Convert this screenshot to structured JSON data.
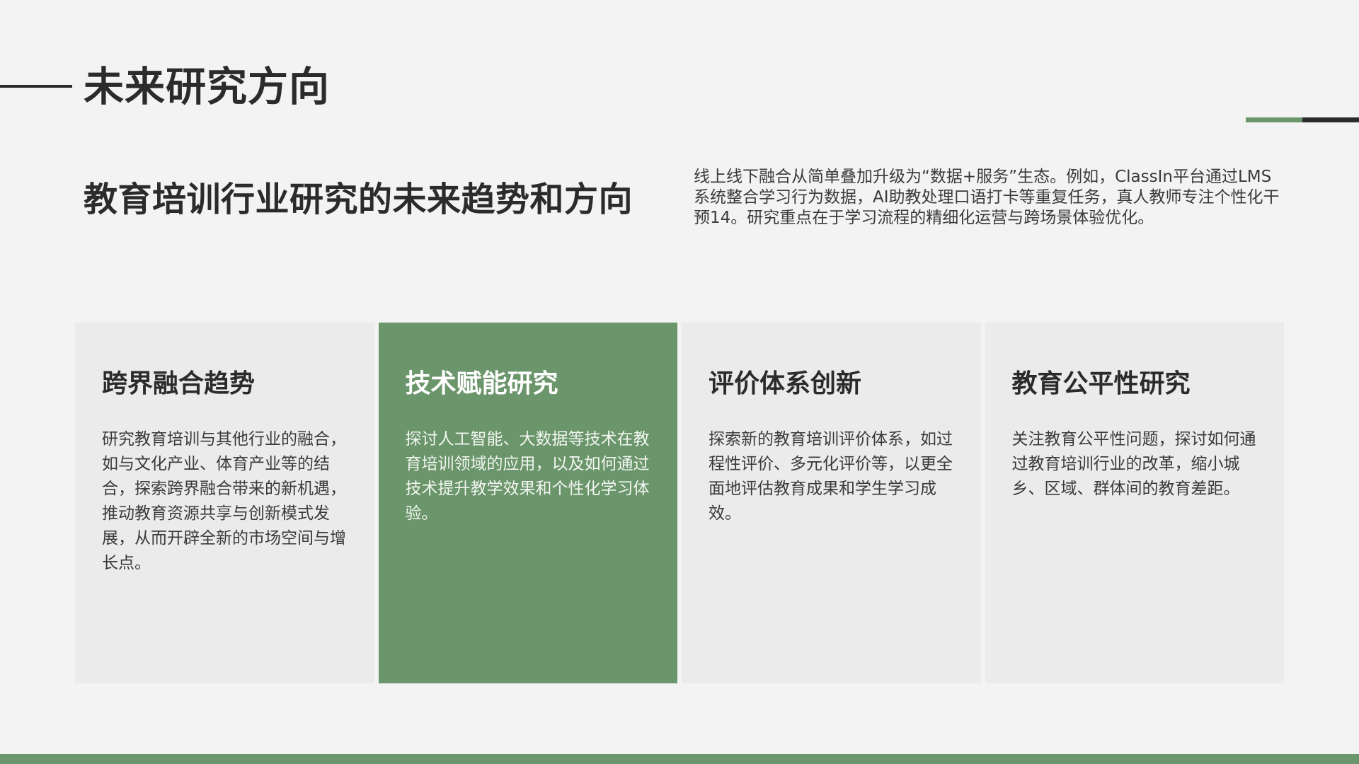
{
  "header": {
    "title": "未来研究方向"
  },
  "section": {
    "subtitle": "教育培训行业研究的未来趋势和方向",
    "intro": "线上线下融合从简单叠加升级为“数据+服务”生态。例如，ClassIn平台通过LMS系统整合学习行为数据，AI助教处理口语打卡等重复任务，真人教师专注个性化干预14。研究重点在于学习流程的精细化运营与跨场景体验优化。"
  },
  "cards": [
    {
      "title": "跨界融合趋势",
      "body": "研究教育培训与其他行业的融合，如与文化产业、体育产业等的结合，探索跨界融合带来的新机遇，推动教育资源共享与创新模式发展，从而开辟全新的市场空间与增长点。"
    },
    {
      "title": "技术赋能研究",
      "body": "探讨人工智能、大数据等技术在教育培训领域的应用，以及如何通过技术提升教学效果和个性化学习体验。"
    },
    {
      "title": "评价体系创新",
      "body": "探索新的教育培训评价体系，如过程性评价、多元化评价等，以更全面地评估教育成果和学生学习成效。"
    },
    {
      "title": "教育公平性研究",
      "body": "关注教育公平性问题，探讨如何通过教育培训行业的改革，缩小城乡、区域、群体间的教育差距。"
    }
  ],
  "colors": {
    "accent_green": "#6b956a",
    "text_dark": "#2b2b2b",
    "background": "#f3f3f3",
    "card_background": "#ebebeb"
  }
}
